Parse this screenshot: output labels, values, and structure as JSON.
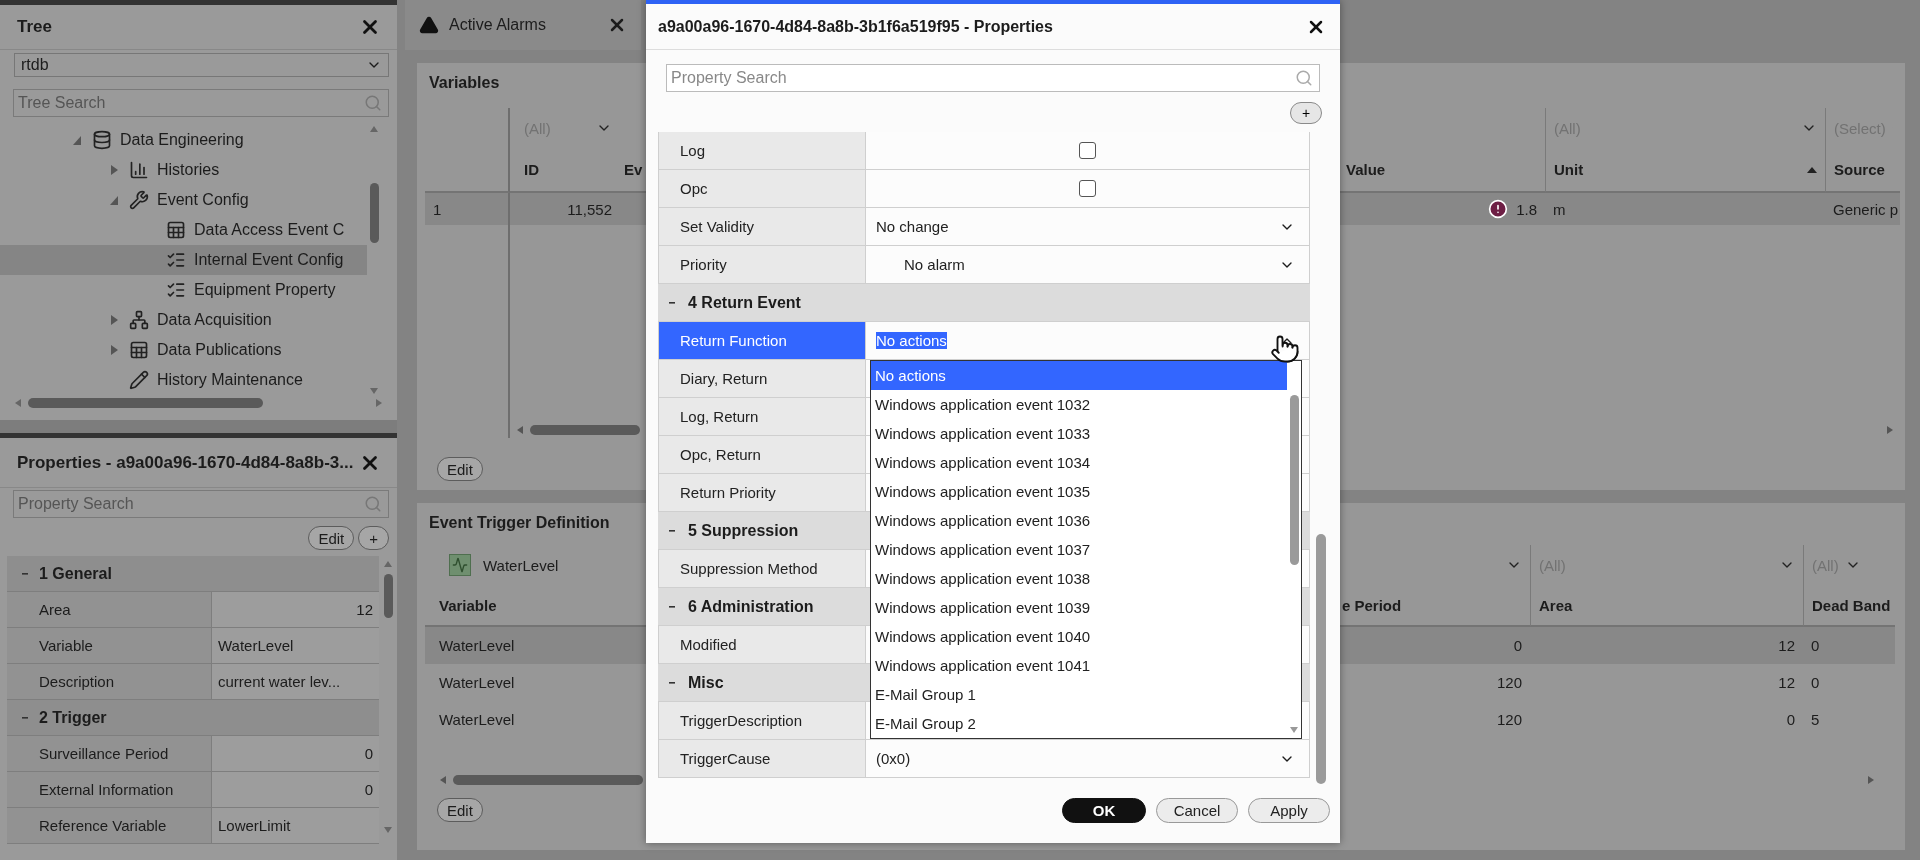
{
  "tree_panel": {
    "title": "Tree",
    "database": "rtdb",
    "search": {
      "placeholder": "Tree Search"
    },
    "items": [
      {
        "label": "Data Engineering",
        "kind": "database",
        "expanded": true,
        "selected": false,
        "children": [
          {
            "label": "Histories",
            "kind": "chart",
            "expanded": false,
            "selected": false
          },
          {
            "label": "Event Config",
            "kind": "wrench",
            "expanded": true,
            "selected": false,
            "children": [
              {
                "label": "Data Access Event C",
                "kind": "sheet",
                "selected": false
              },
              {
                "label": "Internal Event Config",
                "kind": "checklist",
                "selected": true
              },
              {
                "label": "Equipment Property",
                "kind": "checklist",
                "selected": false
              }
            ]
          },
          {
            "label": "Data Acquisition",
            "kind": "network",
            "expanded": false,
            "selected": false
          },
          {
            "label": "Data Publications",
            "kind": "sheet",
            "expanded": false,
            "selected": false
          },
          {
            "label": "History Maintenance",
            "kind": "pencil",
            "selected": false
          }
        ]
      }
    ]
  },
  "properties_panel": {
    "title": "Properties - a9a00a96-1670-4d84-8a8b-3...",
    "search": {
      "placeholder": "Property Search"
    },
    "buttons": [
      "Edit",
      "+"
    ],
    "groups": [
      {
        "title": "1 General",
        "expanded": true,
        "rows": [
          {
            "label": "Area",
            "value": "12",
            "kind": "number"
          },
          {
            "label": "Variable",
            "value": "WaterLevel",
            "kind": "text"
          },
          {
            "label": "Description",
            "value": "current water lev...",
            "kind": "text"
          }
        ]
      },
      {
        "title": "2 Trigger",
        "expanded": true,
        "rows": [
          {
            "label": "Surveillance Period",
            "value": "0",
            "kind": "number"
          },
          {
            "label": "External Information",
            "value": "0",
            "kind": "number"
          },
          {
            "label": "Reference Variable",
            "value": "LowerLimit",
            "kind": "text"
          }
        ]
      }
    ]
  },
  "tabs": [
    {
      "label": "Active Alarms",
      "selected": true
    }
  ],
  "variables": {
    "title": "Variables",
    "columns": {
      "id": {
        "label": "ID",
        "filter": "(All)"
      },
      "column_3": {
        "label": "Ev"
      },
      "value": {
        "label": "Value"
      },
      "unit": {
        "label": "Unit",
        "filter": "(All)",
        "sort_ascending": true
      },
      "source": {
        "label": "Source",
        "filter": "(Select)"
      }
    },
    "rows": [
      {
        "number": "1",
        "id": "11,552",
        "value": "1.8",
        "alarm": true,
        "unit": "m",
        "source": "Generic p",
        "selected": true
      }
    ],
    "edit_button": "Edit"
  },
  "event_trigger": {
    "title": "Event Trigger Definition",
    "variable_filter": "WaterLevel",
    "columns": {
      "variable": {
        "label": "Variable"
      },
      "period": {
        "label": "e Period",
        "filter_button": true
      },
      "area": {
        "label": "Area",
        "filter": "(All)"
      },
      "dead_band": {
        "label": "Dead Band",
        "filter": "(All)"
      }
    },
    "rows": [
      {
        "variable": "WaterLevel",
        "period": "0",
        "area": "12",
        "dead_band": "0",
        "selected": true
      },
      {
        "variable": "WaterLevel",
        "period": "120",
        "area": "12",
        "dead_band": "0",
        "selected": false
      },
      {
        "variable": "WaterLevel",
        "period": "120",
        "area": "0",
        "dead_band": "5",
        "selected": false
      }
    ],
    "edit_button": "Edit"
  },
  "dialog": {
    "title": "a9a00a96-1670-4d84-8a8b-3b1f6a519f95 - Properties",
    "search": {
      "placeholder": "Property Search"
    },
    "add_button": "+",
    "rows": [
      {
        "kind": "checkbox",
        "label": "Log",
        "checked": false,
        "selected": false
      },
      {
        "kind": "checkbox",
        "label": "Opc",
        "checked": false,
        "selected": false
      },
      {
        "kind": "select",
        "label": "Set Validity",
        "value": "No change",
        "selected": false
      },
      {
        "kind": "select-icon",
        "label": "Priority",
        "value": "No alarm",
        "selected": false
      },
      {
        "kind": "group",
        "label": "4 Return Event",
        "expanded": true
      },
      {
        "kind": "select",
        "label": "Return Function",
        "value": "No actions",
        "selected": true,
        "open": true,
        "options": [
          {
            "label": "No actions",
            "selected": true
          },
          {
            "label": "Windows application event 1032",
            "selected": false
          },
          {
            "label": "Windows application event 1033",
            "selected": false
          },
          {
            "label": "Windows application event 1034",
            "selected": false
          },
          {
            "label": "Windows application event 1035",
            "selected": false
          },
          {
            "label": "Windows application event 1036",
            "selected": false
          },
          {
            "label": "Windows application event 1037",
            "selected": false
          },
          {
            "label": "Windows application event 1038",
            "selected": false
          },
          {
            "label": "Windows application event 1039",
            "selected": false
          },
          {
            "label": "Windows application event 1040",
            "selected": false
          },
          {
            "label": "Windows application event 1041",
            "selected": false
          },
          {
            "label": "E-Mail Group 1",
            "selected": false
          },
          {
            "label": "E-Mail Group 2",
            "selected": false
          }
        ]
      },
      {
        "kind": "label",
        "label": "Diary, Return",
        "selected": false
      },
      {
        "kind": "label",
        "label": "Log, Return",
        "selected": false
      },
      {
        "kind": "label",
        "label": "Opc, Return",
        "selected": false
      },
      {
        "kind": "label",
        "label": "Return Priority",
        "selected": false
      },
      {
        "kind": "group",
        "label": "5 Suppression",
        "expanded": true
      },
      {
        "kind": "label",
        "label": "Suppression Method",
        "selected": false
      },
      {
        "kind": "group",
        "label": "6 Administration",
        "expanded": true
      },
      {
        "kind": "label",
        "label": "Modified",
        "selected": false
      },
      {
        "kind": "group",
        "label": "Misc",
        "expanded": true
      },
      {
        "kind": "label",
        "label": "TriggerDescription",
        "selected": false
      },
      {
        "kind": "select",
        "label": "TriggerCause",
        "value": "(0x0)",
        "selected": false
      }
    ],
    "buttons": [
      {
        "label": "OK",
        "kind": "primary"
      },
      {
        "label": "Cancel",
        "kind": "secondary"
      },
      {
        "label": "Apply",
        "kind": "secondary"
      }
    ]
  }
}
